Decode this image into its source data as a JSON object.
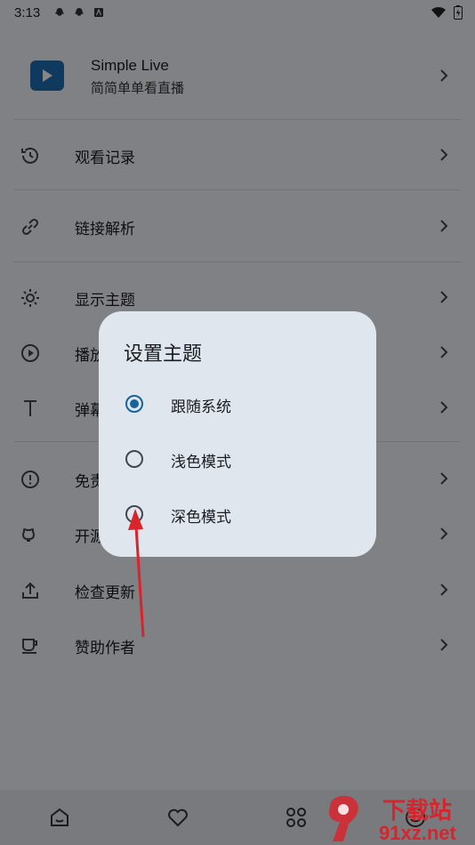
{
  "status_bar": {
    "time": "3:13"
  },
  "app": {
    "name": "Simple Live",
    "subtitle": "简简单单看直播"
  },
  "menu": [
    {
      "label": "观看记录",
      "icon": "history-icon"
    },
    {
      "label": "链接解析",
      "icon": "link-icon"
    },
    {
      "label": "显示主题",
      "icon": "brightness-icon"
    },
    {
      "label": "播放设置",
      "icon": "play-circle-icon"
    },
    {
      "label": "弹幕设置",
      "icon": "text-icon"
    },
    {
      "label": "免责声明",
      "icon": "alert-circle-icon"
    },
    {
      "label": "开源主页",
      "icon": "github-icon"
    },
    {
      "label": "检查更新",
      "icon": "upload-icon"
    },
    {
      "label": "赞助作者",
      "icon": "coffee-icon"
    }
  ],
  "dialog": {
    "title": "设置主题",
    "options": [
      {
        "label": "跟随系统",
        "selected": true
      },
      {
        "label": "浅色模式",
        "selected": false
      },
      {
        "label": "深色模式",
        "selected": false
      }
    ]
  },
  "bottom_nav": [
    "home-icon",
    "heart-icon",
    "category-grid-icon",
    "user-icon"
  ],
  "watermark": {
    "text_big": "下载站",
    "text_small": "91xz.net"
  },
  "colors": {
    "accent": "#17639e",
    "logo": "#1e6fb0",
    "arrow": "#d9242c"
  }
}
